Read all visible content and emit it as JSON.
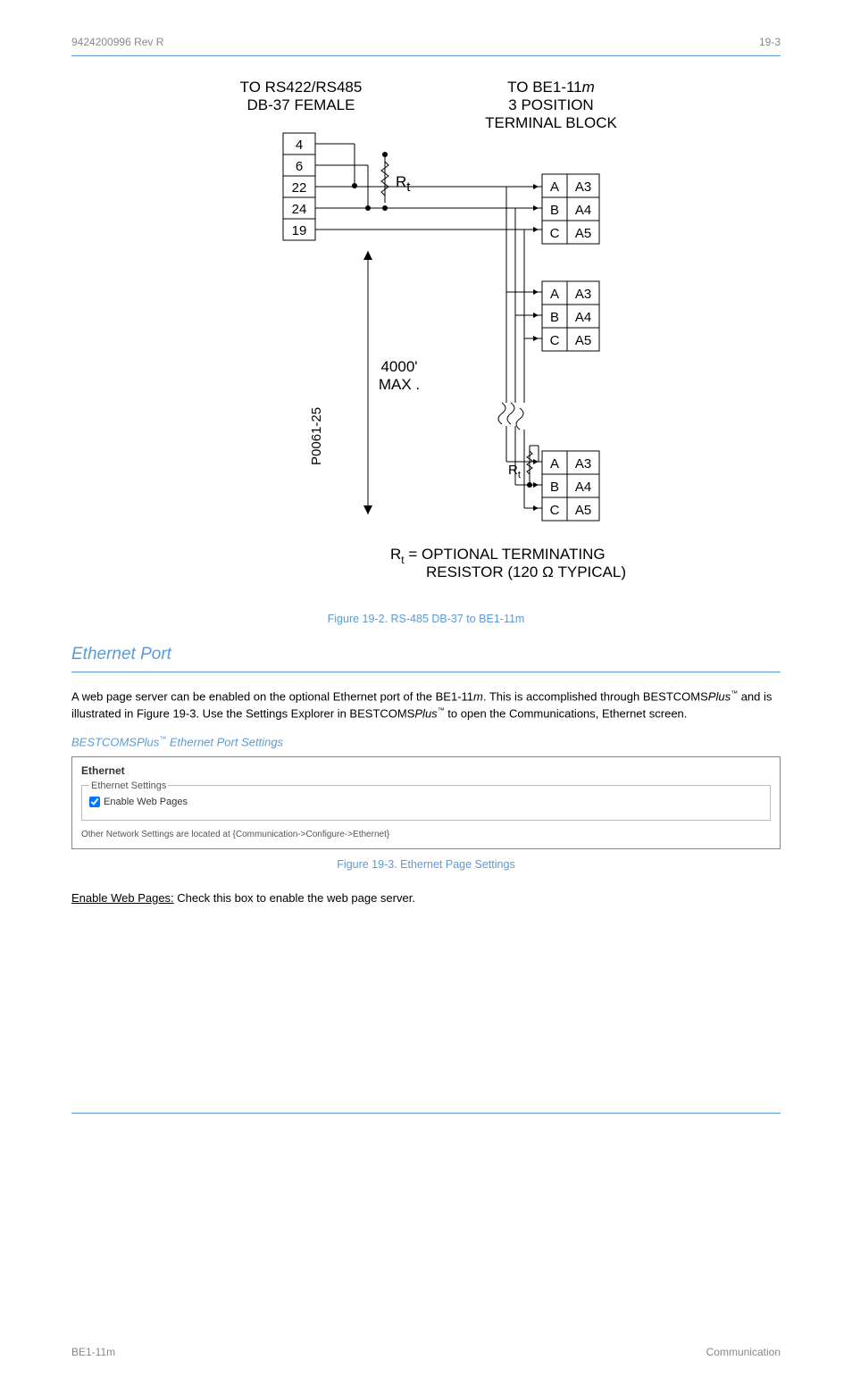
{
  "header": {
    "left": "9424200996 Rev R",
    "right": "19-3"
  },
  "diagram": {
    "left_title_l1": "TO RS422/RS485",
    "left_title_l2": "DB-37  FEMALE",
    "right_title_l1": "TO BE1-11",
    "right_title_m": "m",
    "right_title_l2": "3 POSITION",
    "right_title_l3": "TERMINAL BLOCK",
    "pins": [
      "4",
      "6",
      "22",
      "24",
      "19"
    ],
    "rt": "R",
    "rt_sub": "t",
    "len_l1": "4000'",
    "len_l2": "MAX",
    "len_dot": ".",
    "tb_letters": [
      "A",
      "B",
      "C"
    ],
    "tb_labels": [
      "A3",
      "A4",
      "A5"
    ],
    "part": "P0061-25",
    "note_pre": "R",
    "note_sub": "t",
    "note_rest1": " = OPTIONAL TERMINATING",
    "note_rest2": "RESISTOR (120 Ω TYPICAL)"
  },
  "fig_caption": "Figure 19-2. RS-485 DB-37 to BE1-11m",
  "section_title": "Ethernet Port",
  "para1_a": "A web page server can be enabled on the optional Ethernet port of the BE1-11",
  "para1_m": "m",
  "para1_b": ". This is accomplished through BESTCOMS",
  "para1_plus": "Plus",
  "para1_c": " and is illustrated in Figure 19-3. Use the Settings Explorer in BESTCOMS",
  "para1_d": " to open the Communications, Ethernet screen.",
  "subhead": "BESTCOMS",
  "subhead_plus": "Plus",
  "subhead_tm": "™",
  "subhead_tail": " Ethernet Port Settings",
  "screenshot": {
    "title": "Ethernet",
    "legend": "Ethernet Settings",
    "checkbox": "Enable Web Pages",
    "linktext": "Other Network Settings are located at {Communication->Configure->Ethernet}"
  },
  "fig_caption2": "Figure 19-3. Ethernet Page Settings",
  "after_para": "Enable Web Pages:",
  "after_para2": " Check this box to enable the web page server.",
  "footer": {
    "left": "BE1-11m",
    "right": "Communication"
  }
}
